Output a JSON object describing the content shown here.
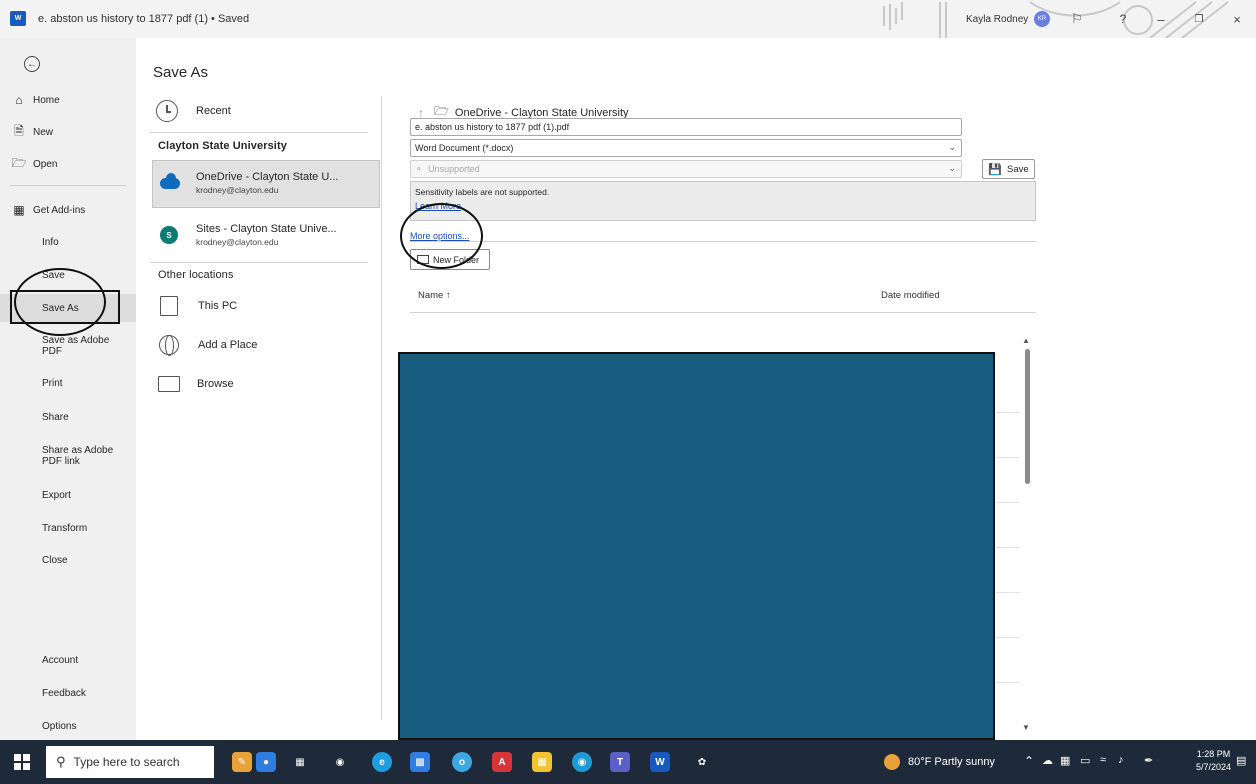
{
  "window": {
    "app_logo": "W",
    "doc_title": "e. abston us history to 1877 pdf (1) • Saved",
    "user_name": "Kayla Rodney",
    "user_initials": "KR"
  },
  "nav": {
    "items": [
      {
        "label": "Home",
        "icon": "home-icon"
      },
      {
        "label": "New",
        "icon": "new-doc-icon"
      },
      {
        "label": "Open",
        "icon": "open-folder-icon"
      },
      {
        "label": "Get Add-ins",
        "icon": "add-ins-icon"
      },
      {
        "label": "Info"
      },
      {
        "label": "Save"
      },
      {
        "label": "Save As"
      },
      {
        "label": "Save as Adobe PDF"
      },
      {
        "label": "Print"
      },
      {
        "label": "Share"
      },
      {
        "label": "Share as Adobe PDF link"
      },
      {
        "label": "Export"
      },
      {
        "label": "Transform"
      },
      {
        "label": "Close"
      },
      {
        "label": "Account"
      },
      {
        "label": "Feedback"
      },
      {
        "label": "Options"
      }
    ]
  },
  "main": {
    "title": "Save As",
    "recent_label": "Recent",
    "org_section": "Clayton State University",
    "onedrive": {
      "title": "OneDrive - Clayton State U...",
      "email": "krodney@clayton.edu"
    },
    "sites": {
      "title": "Sites - Clayton State Unive...",
      "email": "krodney@clayton.edu"
    },
    "other_section": "Other locations",
    "this_pc": "This PC",
    "add_place": "Add a Place",
    "browse": "Browse"
  },
  "right": {
    "path": "OneDrive - Clayton State University",
    "filename": "e. abston us history to 1877 pdf (1).pdf",
    "filetype": "Word Document (*.docx)",
    "sensitivity": "Unsupported",
    "save_label": "Save",
    "sens_message": "Sensitivity labels are not supported.",
    "learn_more": "Learn More",
    "more_options": "More options...",
    "new_folder": "New Folder",
    "col_name": "Name ↑",
    "col_date": "Date modified"
  },
  "taskbar": {
    "search_placeholder": "Type here to search",
    "weather": "80°F  Partly sunny",
    "time": "1:28 PM",
    "date": "5/7/2024"
  },
  "colors": {
    "word_blue": "#185abd",
    "link": "#1b4fb6",
    "redaction": "#185d80"
  }
}
